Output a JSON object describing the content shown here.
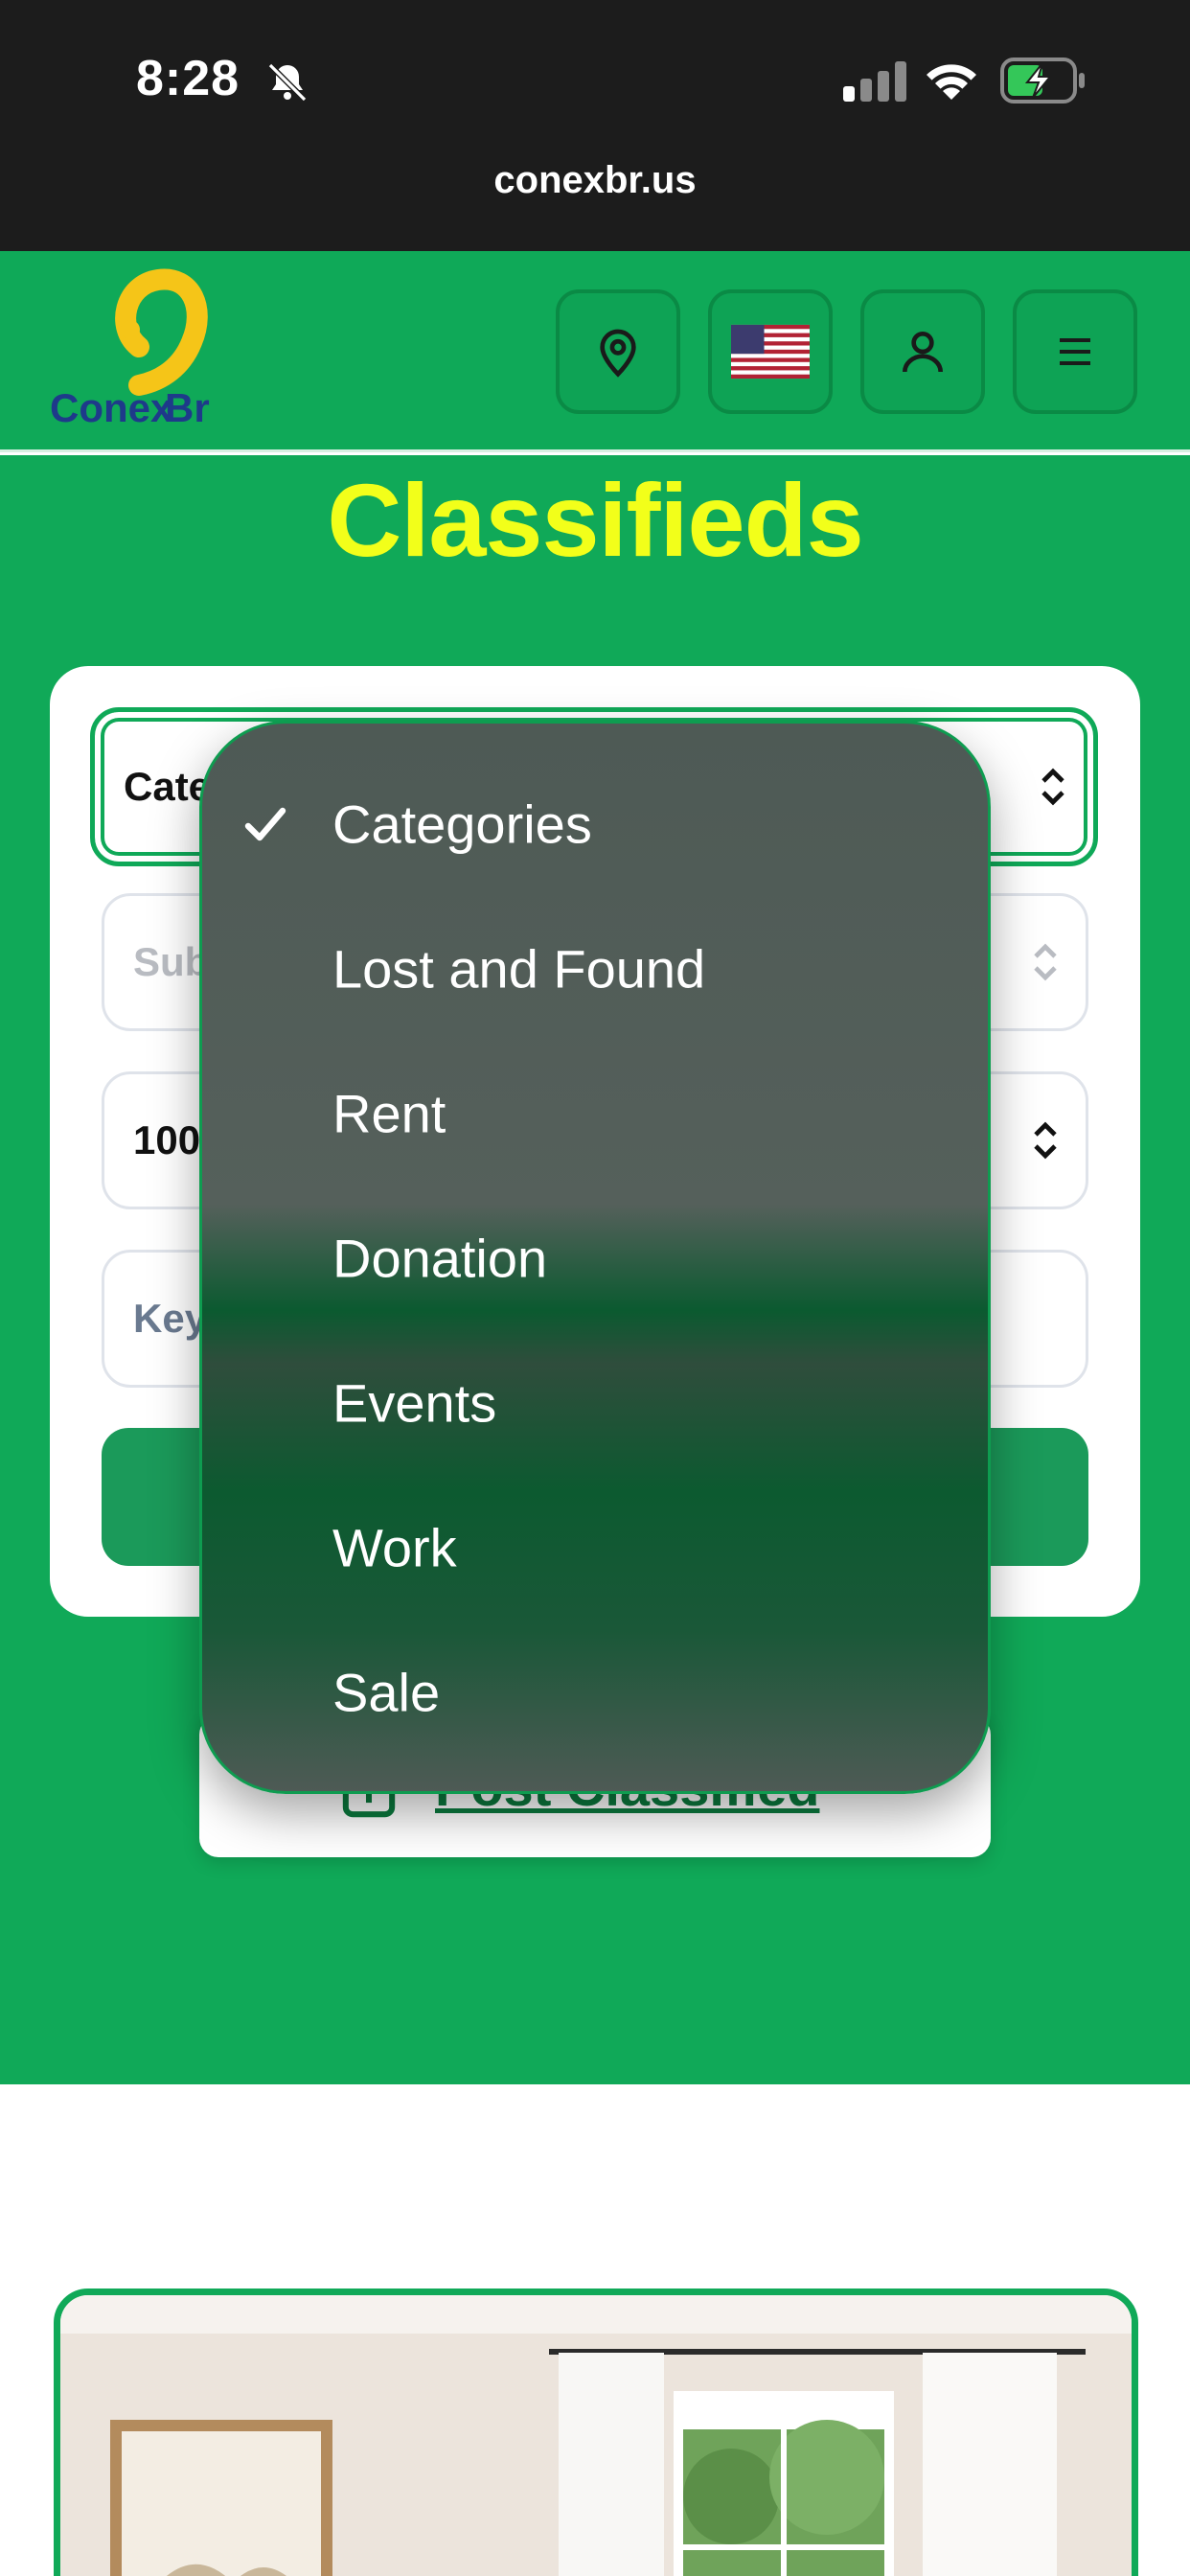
{
  "status_bar": {
    "time": "8:28",
    "url": "conexbr.us"
  },
  "header": {
    "logo_text": "ConexBr",
    "buttons": [
      "location-icon",
      "us-flag-icon",
      "user-icon",
      "menu-icon"
    ]
  },
  "hero": {
    "title": "Classifieds"
  },
  "form": {
    "category_value": "Categories",
    "subcategory_placeholder": "Subcategories",
    "distance_value": "100",
    "keyword_placeholder": "Keyword"
  },
  "post": {
    "label": "Post Classified"
  },
  "dropdown": {
    "selected": "Categories",
    "options": [
      "Categories",
      "Lost and Found",
      "Rent",
      "Donation",
      "Events",
      "Work",
      "Sale"
    ]
  },
  "colors": {
    "brand_green": "#10a958",
    "title_yellow": "#f2ff1a",
    "dark": "#1c1c1c"
  }
}
